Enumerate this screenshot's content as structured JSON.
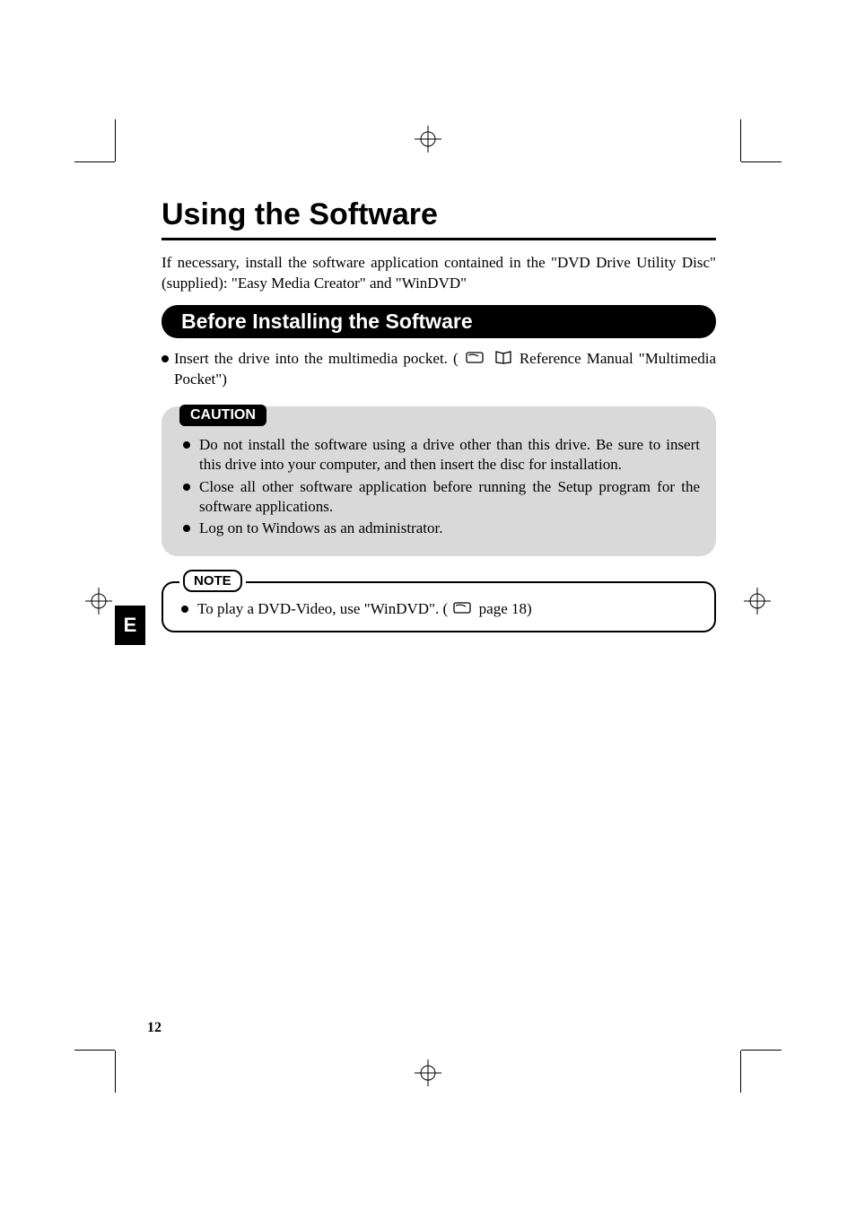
{
  "title": "Using the Software",
  "intro": "If necessary, install the software application contained in the \"DVD Drive Utility Disc\" (supplied): \"Easy Media Creator\" and \"WinDVD\"",
  "section_heading": "Before Installing the Software",
  "insert_text_before": "Insert the drive into the multimedia pocket. (",
  "insert_text_after": " Reference Manual \"Multimedia Pocket\")",
  "side_tab": "E",
  "caution": {
    "label": "CAUTION",
    "items": [
      "Do not install the software using a drive other than this drive. Be sure to insert this drive into your computer, and then insert the disc for installation.",
      "Close all other software application before running the Setup program for the software applications.",
      "Log on to Windows as an administrator."
    ]
  },
  "note": {
    "label": "NOTE",
    "text_before": "To play a DVD-Video, use \"WinDVD\". (",
    "text_after": " page 18)"
  },
  "page_number": "12"
}
